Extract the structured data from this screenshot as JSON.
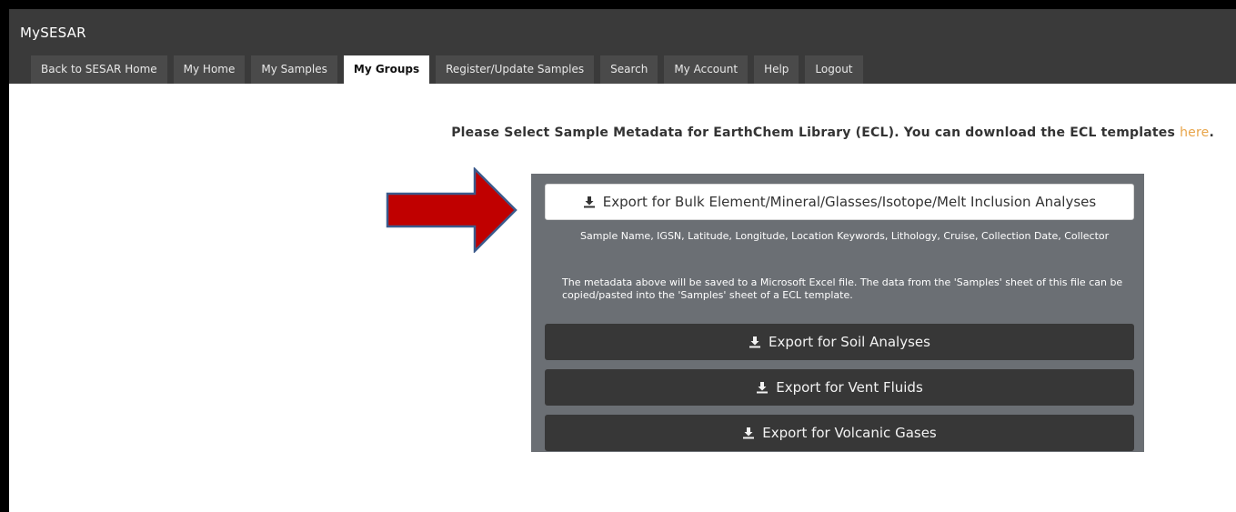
{
  "app": {
    "title": "MySESAR"
  },
  "nav": {
    "tabs": [
      {
        "label": "Back to SESAR Home"
      },
      {
        "label": "My Home"
      },
      {
        "label": "My Samples"
      },
      {
        "label": "My Groups",
        "active": true
      },
      {
        "label": "Register/Update Samples"
      },
      {
        "label": "Search"
      },
      {
        "label": "My Account"
      },
      {
        "label": "Help"
      },
      {
        "label": "Logout"
      }
    ]
  },
  "page": {
    "heading": "Please Select Sample Metadata for EarthChem Library (ECL). You can download the ECL templates",
    "heading_link": "here",
    "heading_end": "."
  },
  "export": {
    "bulk_label": "Export for Bulk Element/Mineral/Glasses/Isotope/Melt Inclusion Analyses",
    "bulk_fields": "Sample Name, IGSN, Latitude, Longitude, Location Keywords, Lithology, Cruise, Collection Date, Collector",
    "bulk_note": "The metadata above will be saved to a Microsoft Excel file. The data from the 'Samples' sheet of this file can be copied/pasted into the 'Samples' sheet of a ECL template.",
    "soil_label": "Export for Soil Analyses",
    "vent_label": "Export for Vent Fluids",
    "volcanic_label": "Export for Volcanic Gases"
  },
  "icons": {
    "download": "download-icon",
    "arrow": "red-arrow-pointer"
  },
  "colors": {
    "navbar": "#3a3a3a",
    "tab": "#4a4a4a",
    "panel": "#6b6f74",
    "dark_button": "#373737",
    "link": "#e8a54a",
    "arrow_fill": "#c00000",
    "arrow_stroke": "#3b5a8c"
  }
}
